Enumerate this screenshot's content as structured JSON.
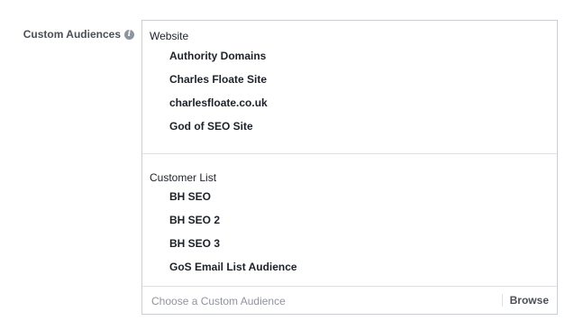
{
  "field": {
    "label": "Custom Audiences",
    "info_icon": "i"
  },
  "groups": [
    {
      "header": "Website",
      "items": [
        "Authority Domains",
        "Charles Floate Site",
        "charlesfloate.co.uk",
        "God of SEO Site"
      ]
    },
    {
      "header": "Customer List",
      "items": [
        "BH SEO",
        "BH SEO 2",
        "BH SEO 3",
        "GoS Email List Audience"
      ]
    }
  ],
  "chooser": {
    "placeholder": "Choose a Custom Audience",
    "browse_label": "Browse"
  }
}
